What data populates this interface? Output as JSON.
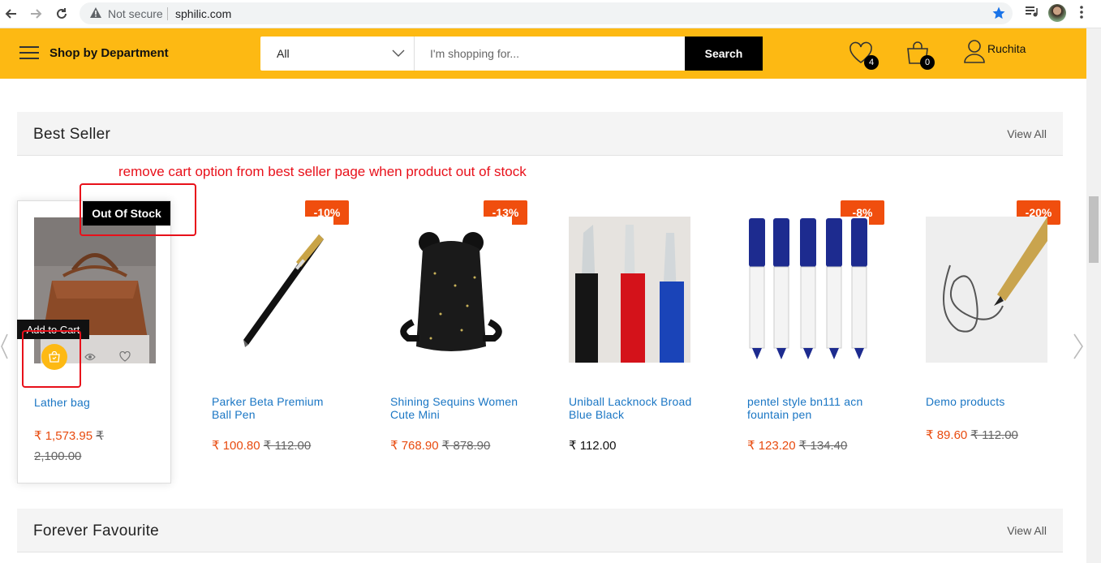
{
  "browser": {
    "security_label": "Not secure",
    "url": "sphilic.com"
  },
  "header": {
    "department_label": "Shop by Department",
    "category_selected": "All",
    "search_placeholder": "I'm shopping for...",
    "search_button": "Search",
    "wishlist_count": "4",
    "cart_count": "0",
    "user_name": "Ruchita",
    "accent_color": "#fdb913"
  },
  "best_seller": {
    "title": "Best Seller",
    "view_all": "View All",
    "annotation": "remove cart option from best seller page when product out of stock",
    "out_of_stock_label": "Out Of Stock",
    "tooltip": "Add to Cart",
    "products": [
      {
        "name": "Lather bag",
        "price": "₹ 1,573.95",
        "old_price_part1": "₹",
        "old_price_part2": "2,100.00"
      },
      {
        "name": "Parker Beta Premium Ball Pen",
        "discount": "-10%",
        "price": "₹ 100.80",
        "old_price": "₹ 112.00"
      },
      {
        "name": "Shining Sequins Women Cute Mini",
        "discount": "-13%",
        "price": "₹ 768.90",
        "old_price": "₹ 878.90"
      },
      {
        "name": "Uniball Lacknock Broad Blue Black",
        "price": "₹ 112.00"
      },
      {
        "name": "pentel style bn111 acn fountain pen",
        "discount": "-8%",
        "price": "₹ 123.20",
        "old_price": "₹ 134.40"
      },
      {
        "name": "Demo products",
        "discount": "-20%",
        "price": "₹ 89.60",
        "old_price": "₹ 112.00"
      }
    ]
  },
  "forever_favourite": {
    "title": "Forever Favourite",
    "view_all": "View All"
  }
}
